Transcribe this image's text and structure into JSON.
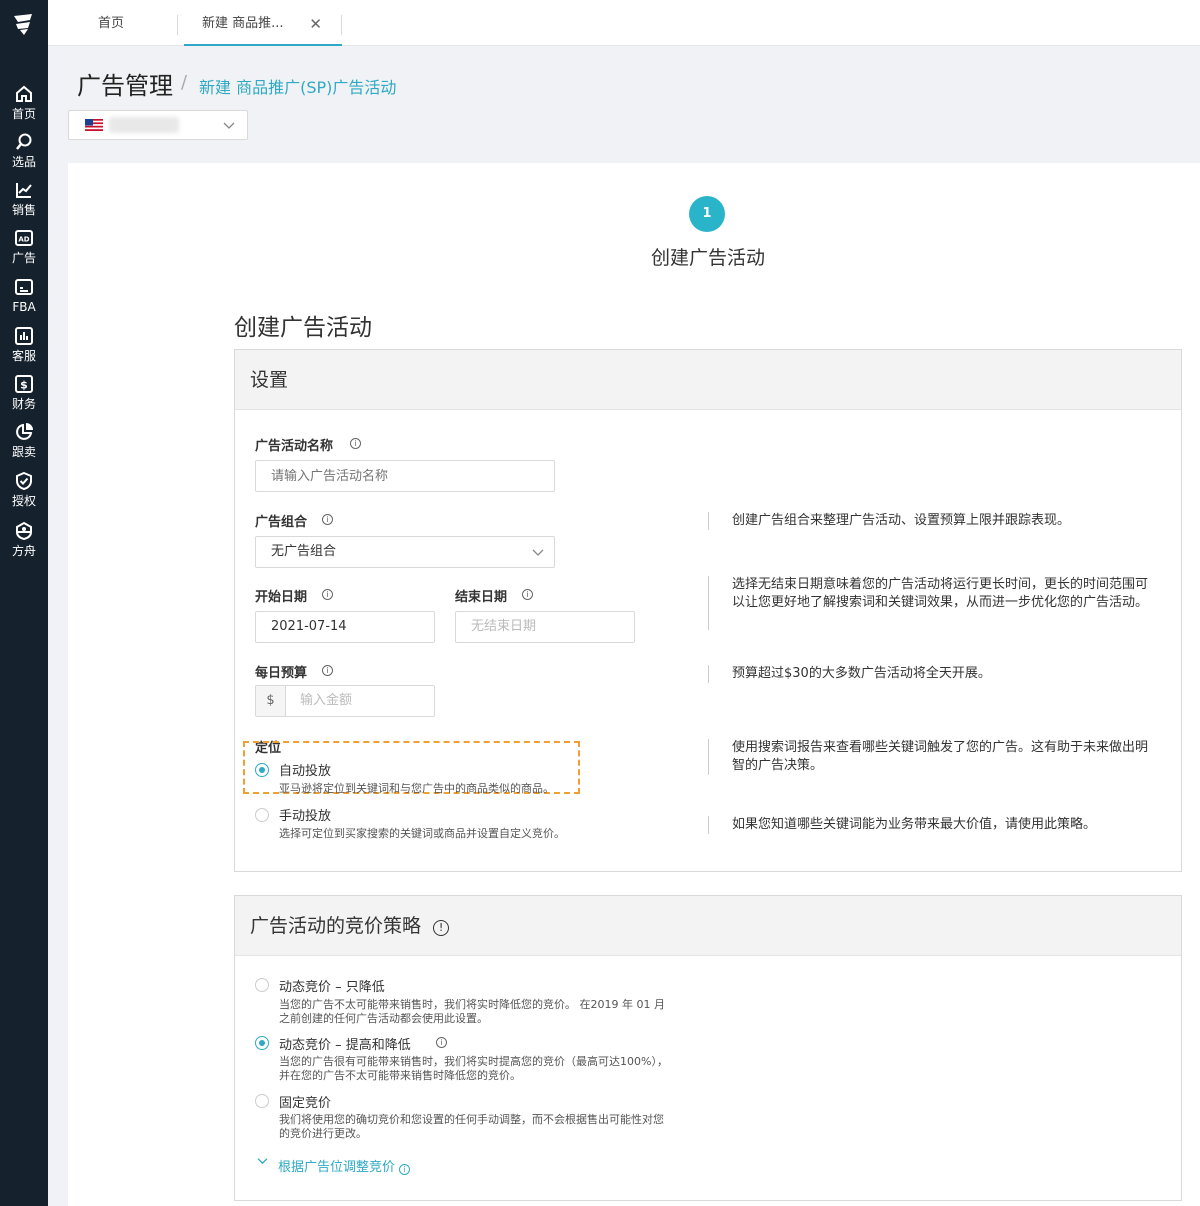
{
  "sidebar": {
    "items": [
      {
        "label": "首页",
        "icon": "home-icon"
      },
      {
        "label": "选品",
        "icon": "search-icon"
      },
      {
        "label": "销售",
        "icon": "chart-line-icon"
      },
      {
        "label": "广告",
        "icon": "ad-icon"
      },
      {
        "label": "FBA",
        "icon": "fba-icon"
      },
      {
        "label": "客服",
        "icon": "service-icon"
      },
      {
        "label": "财务",
        "icon": "dollar-icon"
      },
      {
        "label": "跟卖",
        "icon": "pie-icon"
      },
      {
        "label": "授权",
        "icon": "shield-icon"
      },
      {
        "label": "方舟",
        "icon": "ark-icon"
      }
    ]
  },
  "tabs": {
    "home": "首页",
    "active": "新建 商品推...",
    "close": "✕"
  },
  "header": {
    "title": "广告管理",
    "separator": "/",
    "breadcrumb": "新建 商品推广(SP)广告活动"
  },
  "store": {
    "flag": "us-flag",
    "name_hidden": true
  },
  "steps": {
    "number": "1",
    "label": "创建广告活动"
  },
  "section_title": "创建广告活动",
  "settings": {
    "title": "设置",
    "campaign_name": {
      "label": "广告活动名称",
      "placeholder": "请输入广告活动名称"
    },
    "portfolio": {
      "label": "广告组合",
      "value": "无广告组合",
      "help": "创建广告组合来整理广告活动、设置预算上限并跟踪表现。"
    },
    "start_date": {
      "label": "开始日期",
      "value": "2021-07-14"
    },
    "end_date": {
      "label": "结束日期",
      "placeholder": "无结束日期"
    },
    "dates_help": "选择无结束日期意味着您的广告活动将运行更长时间，更长的时间范围可以让您更好地了解搜索词和关键词效果，从而进一步优化您的广告活动。",
    "budget": {
      "label": "每日预算",
      "currency": "$",
      "placeholder": "输入金额",
      "help": "预算超过$30的大多数广告活动将全天开展。"
    },
    "targeting": {
      "label": "定位",
      "auto": {
        "label": "自动投放",
        "desc": "亚马逊将定位到关键词和与您广告中的商品类似的商品。",
        "help": "使用搜索词报告来查看哪些关键词触发了您的广告。这有助于未来做出明智的广告决策。"
      },
      "manual": {
        "label": "手动投放",
        "desc": "选择可定位到买家搜索的关键词或商品并设置自定义竞价。",
        "help": "如果您知道哪些关键词能为业务带来最大价值，请使用此策略。"
      }
    }
  },
  "bidding": {
    "title": "广告活动的竞价策略",
    "down_only": {
      "label": "动态竞价 – 只降低",
      "desc1": "当您的广告不太可能带来销售时，我们将实时降低您的竞价。 在2019 年 01 月",
      "desc2": "之前创建的任何广告活动都会使用此设置。"
    },
    "up_down": {
      "label": "动态竞价 – 提高和降低",
      "desc1": "当您的广告很有可能带来销售时，我们将实时提高您的竞价（最高可达100%），",
      "desc2": "并在您的广告不太可能带来销售时降低您的竞价。"
    },
    "fixed": {
      "label": "固定竞价",
      "desc1": "我们将使用您的确切竞价和您设置的任何手动调整，而不会根据售出可能性对您",
      "desc2": "的竞价进行更改。"
    },
    "placement_link": "根据广告位调整竞价"
  },
  "colors": {
    "accent": "#2fa9c5",
    "sidebar": "#15212d",
    "highlight": "#f0a030"
  }
}
